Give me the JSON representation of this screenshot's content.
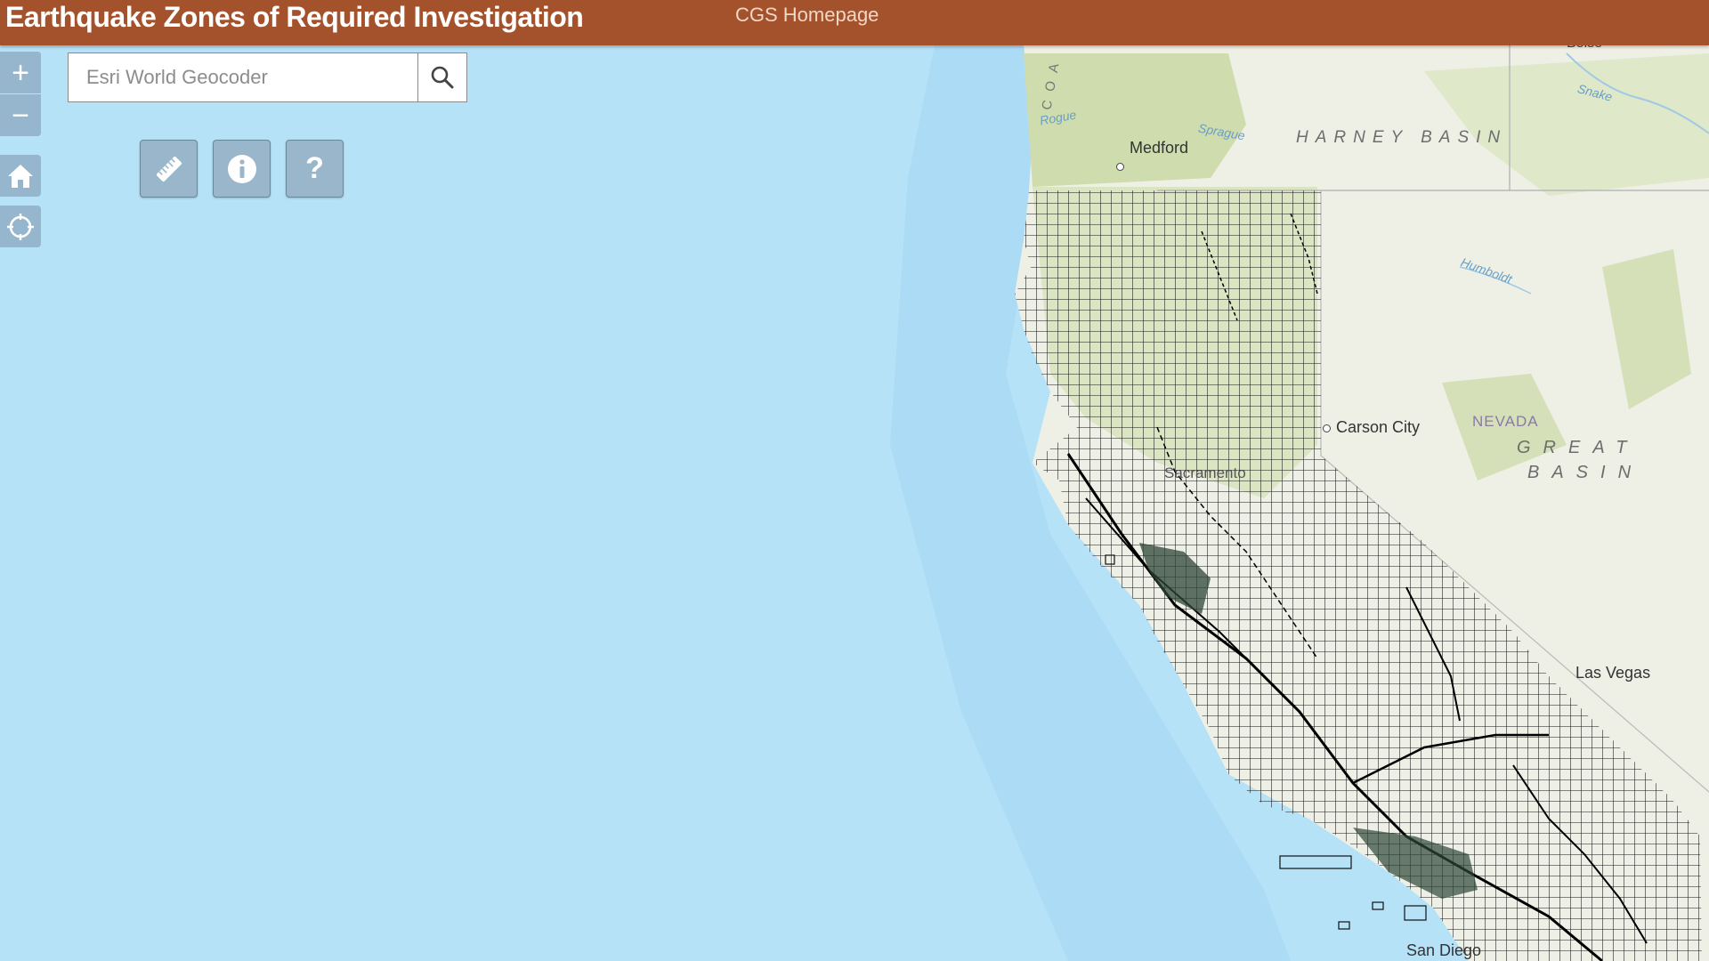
{
  "header": {
    "title": "Earthquake Zones of Required Investigation",
    "link": "CGS Homepage"
  },
  "search": {
    "placeholder": "Esri World Geocoder"
  },
  "controls": {
    "zoom_in": "+",
    "zoom_out": "−",
    "help": "?"
  },
  "map_labels": {
    "medford": "Medford",
    "harney_basin": "HARNEY BASIN",
    "carson_city": "Carson City",
    "nevada": "NEVADA",
    "great": "GREAT",
    "basin": "BASIN",
    "sacramento": "Sacramento",
    "las_vegas": "Las Vegas",
    "san_diego": "San Diego",
    "rogue": "Rogue",
    "sprague": "Sprague",
    "humboldt": "Humboldt",
    "snake": "Snake",
    "coast": "COA",
    "boise": "Boise"
  },
  "colors": {
    "header_bg": "#a4522c",
    "ocean": "#b6e2f8",
    "land": "#eef0e6",
    "forest": "#cfdcae",
    "grid": "#111111"
  }
}
